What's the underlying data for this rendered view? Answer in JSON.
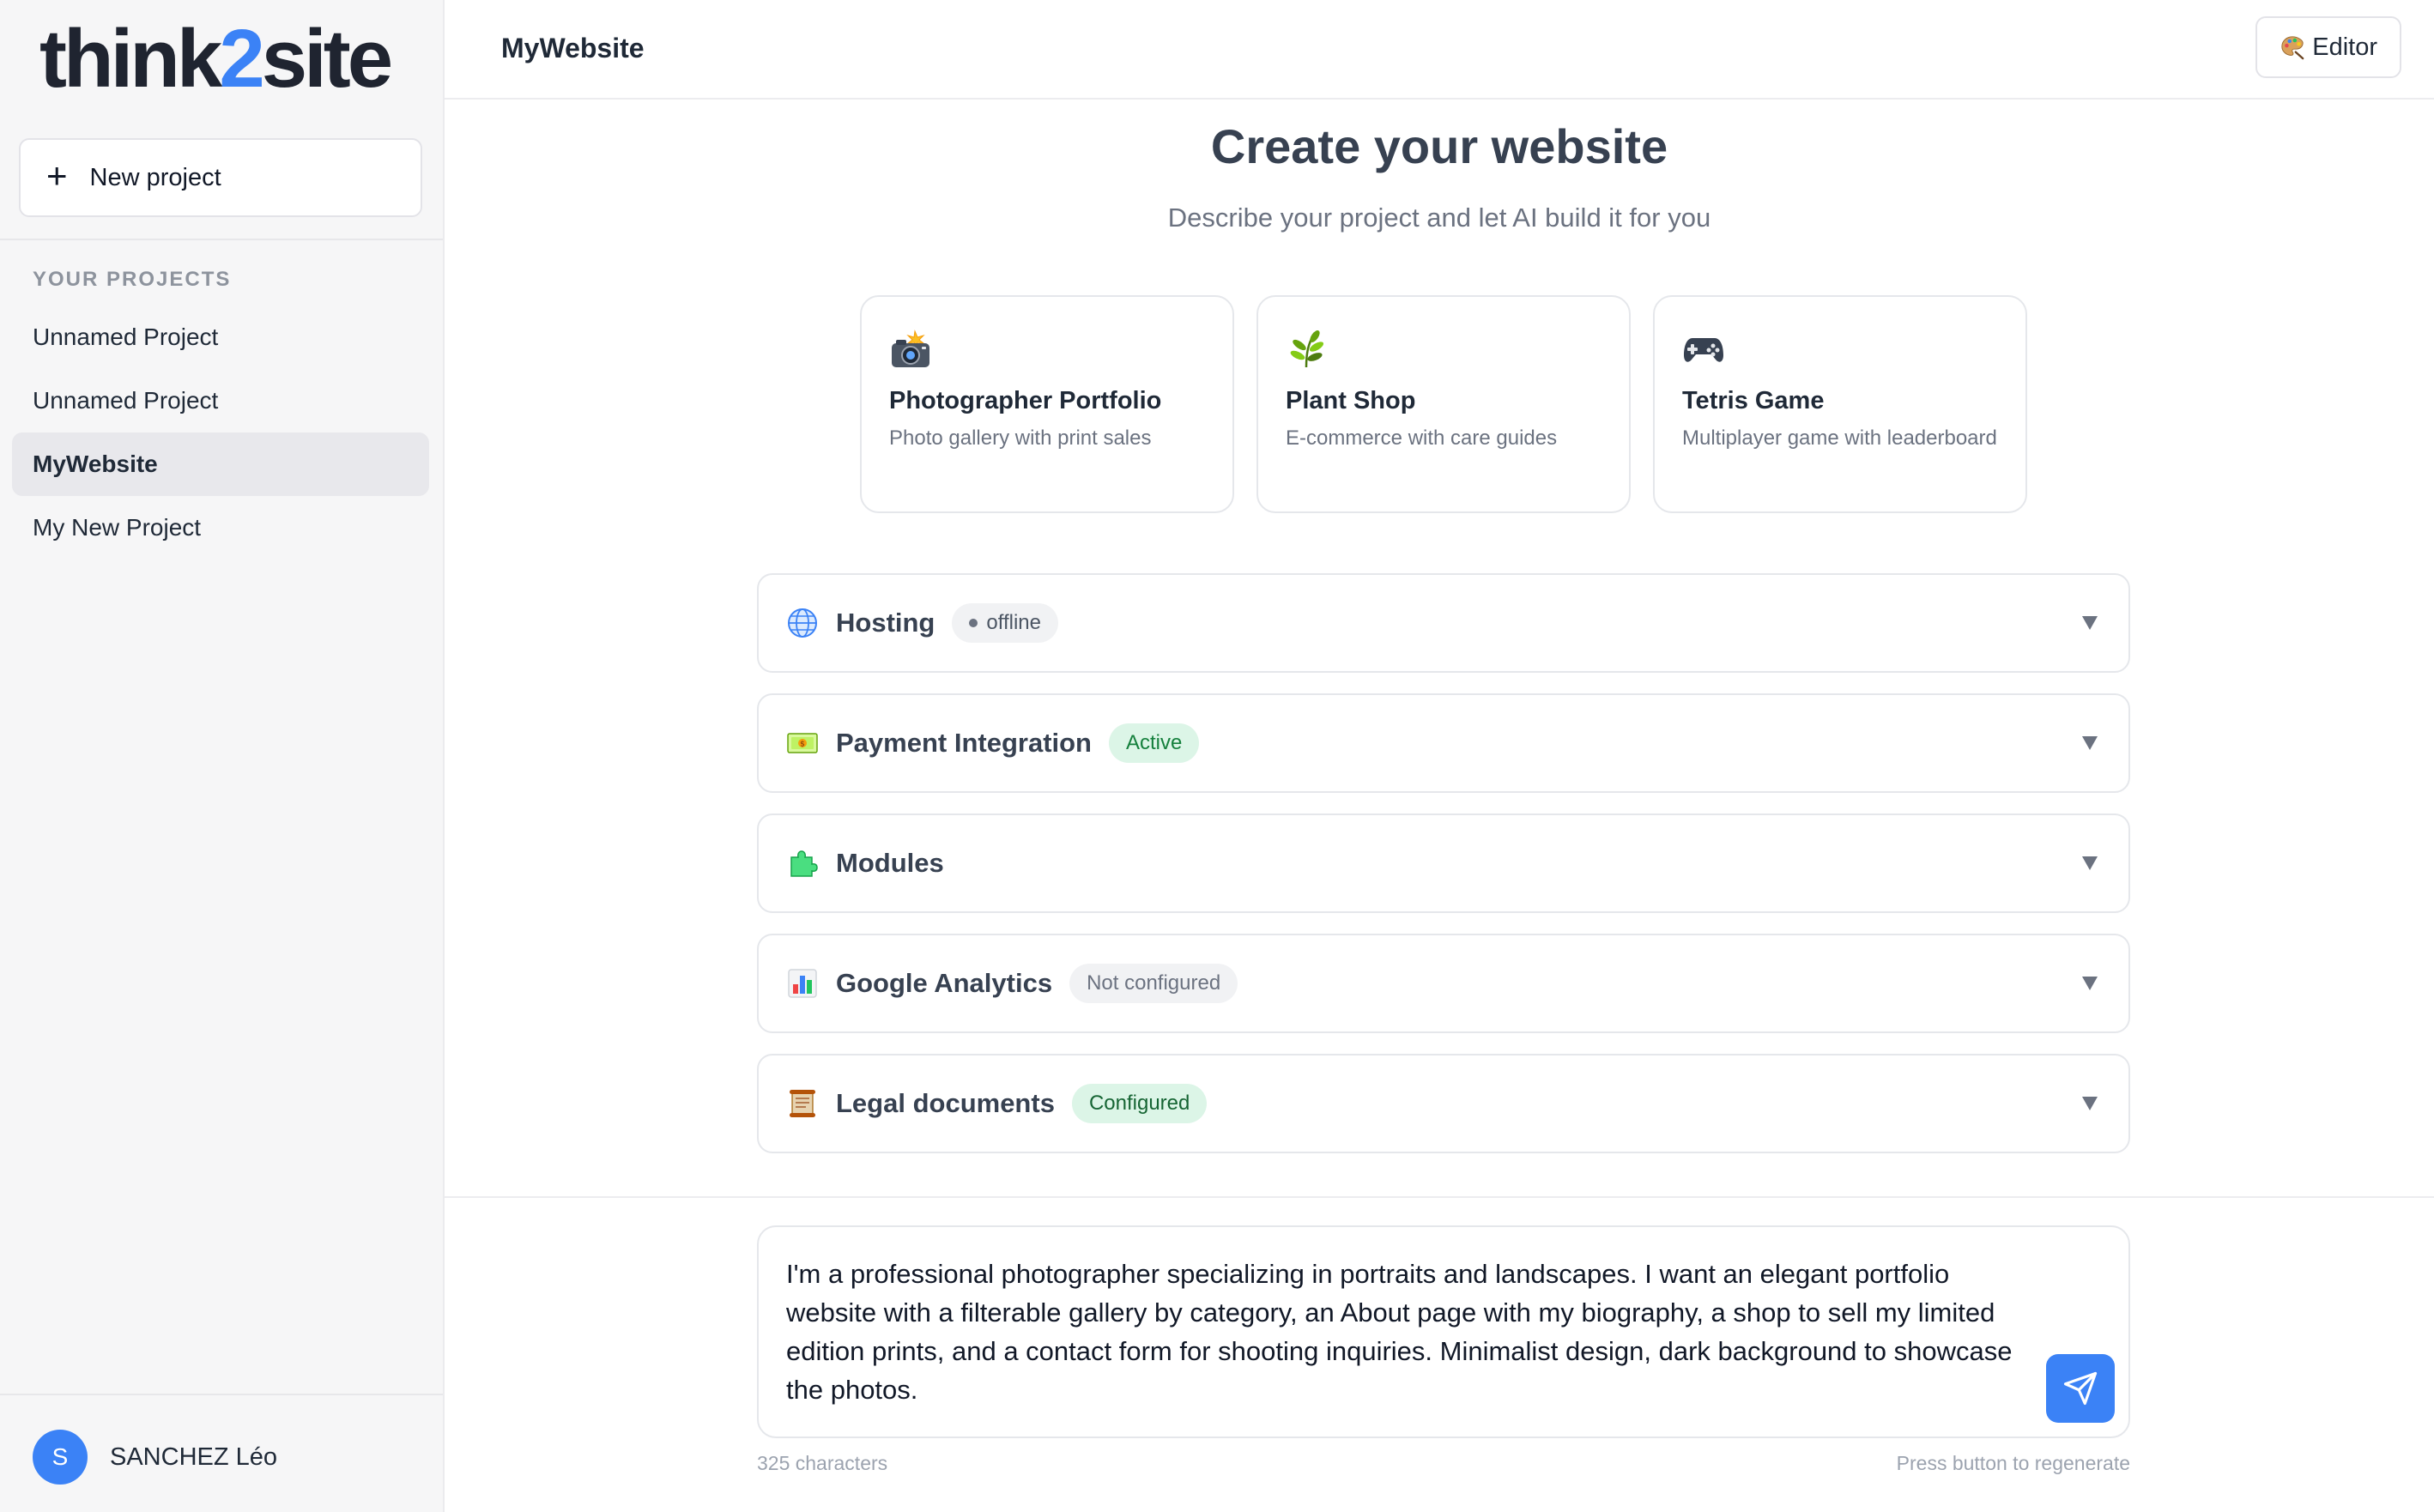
{
  "sidebar": {
    "logo": {
      "part1": "think",
      "part2": "2",
      "part3": "site"
    },
    "new_project_label": "New project",
    "section_label": "YOUR PROJECTS",
    "projects": [
      {
        "label": "Unnamed Project"
      },
      {
        "label": "Unnamed Project"
      },
      {
        "label": "MyWebsite"
      },
      {
        "label": "My New Project"
      }
    ],
    "user": {
      "initial": "S",
      "name": "SANCHEZ Léo"
    }
  },
  "topbar": {
    "title": "MyWebsite",
    "editor_label": "Editor",
    "editor_icon": "palette-icon"
  },
  "main": {
    "title": "Create your website",
    "subtitle": "Describe your project and let AI build it for you",
    "templates": [
      {
        "icon": "camera-flash-icon",
        "title": "Photographer Portfolio",
        "desc": "Photo gallery with print sales"
      },
      {
        "icon": "herb-icon",
        "title": "Plant Shop",
        "desc": "E-commerce with care guides"
      },
      {
        "icon": "game-controller-icon",
        "title": "Tetris Game",
        "desc": "Multiplayer game with leaderboard"
      }
    ],
    "panels": {
      "hosting": {
        "icon": "globe-icon",
        "title": "Hosting",
        "badge": "offline"
      },
      "payment": {
        "icon": "money-icon",
        "title": "Payment Integration",
        "badge": "Active"
      },
      "modules": {
        "icon": "puzzle-icon",
        "title": "Modules"
      },
      "analytics": {
        "icon": "bar-chart-icon",
        "title": "Google Analytics",
        "badge": "Not configured"
      },
      "legal": {
        "icon": "scroll-icon",
        "title": "Legal documents",
        "badge": "Configured"
      }
    }
  },
  "composer": {
    "text": "I'm a professional photographer specializing in portraits and landscapes. I want an elegant portfolio website with a filterable gallery by category, an About page with my biography, a shop to sell my limited edition prints, and a contact form for shooting inquiries. Minimalist design, dark background to showcase the photos.",
    "char_count": "325 characters",
    "hint": "Press button to regenerate"
  },
  "colors": {
    "accent": "#3b82f6",
    "active_badge_bg": "#dcf5e7",
    "active_badge_text": "#15803d"
  }
}
